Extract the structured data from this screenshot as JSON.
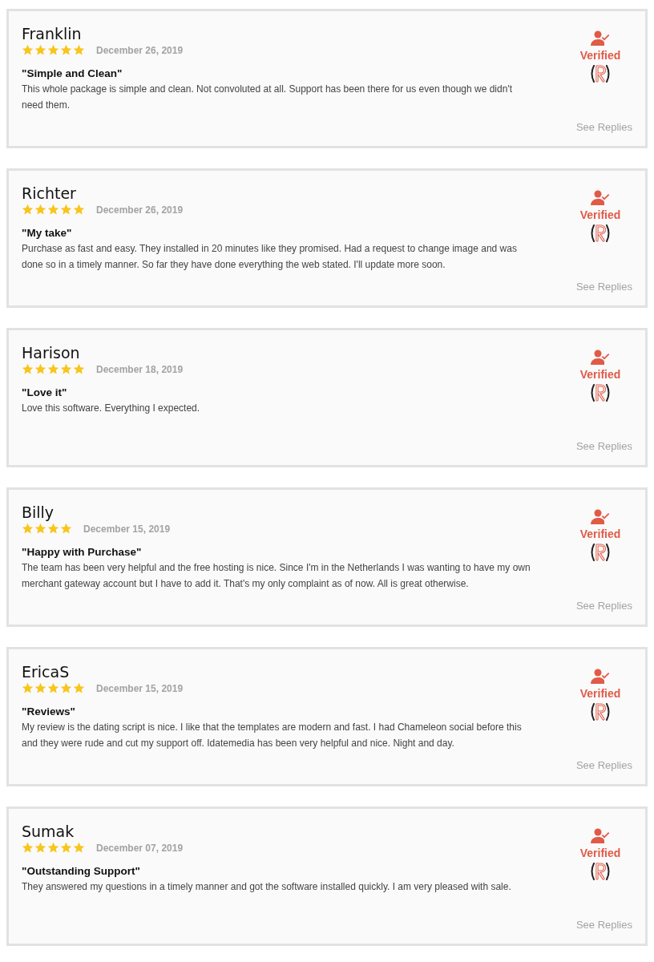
{
  "reviews": [
    {
      "name": "Franklin",
      "stars": 5,
      "date": "December 26, 2019",
      "title": "\"Simple and Clean\"",
      "body": "This whole package is simple and clean. Not convoluted at all. Support has been there for us even though we didn't need them.",
      "verified": "Verified",
      "replies": "See Replies"
    },
    {
      "name": "Richter",
      "stars": 5,
      "date": "December 26, 2019",
      "title": "\"My take\"",
      "body": "Purchase as fast and easy. They installed in 20 minutes like they promised. Had a request to change image and was done so in a timely manner. So far they have done everything the web stated. I'll update more soon.",
      "verified": "Verified",
      "replies": "See Replies"
    },
    {
      "name": "Harison",
      "stars": 5,
      "date": "December 18, 2019",
      "title": "\"Love it\"",
      "body": "Love this software. Everything I expected.",
      "verified": "Verified",
      "replies": "See Replies"
    },
    {
      "name": "Billy",
      "stars": 4,
      "date": "December 15, 2019",
      "title": "\"Happy with Purchase\"",
      "body": "The team has been very helpful and the free hosting is nice. Since I'm in the Netherlands I was wanting to have my own merchant gateway account but I have to add it. That's my only complaint as of now. All is great otherwise.",
      "verified": "Verified",
      "replies": "See Replies"
    },
    {
      "name": "EricaS",
      "stars": 5,
      "date": "December 15, 2019",
      "title": "\"Reviews\"",
      "body": "My review is the dating script is nice. I like that the templates are modern and fast. I had Chameleon social before this and they were rude and cut my support off. Idatemedia has been very helpful and nice. Night and day.",
      "verified": "Verified",
      "replies": "See Replies"
    },
    {
      "name": "Sumak",
      "stars": 5,
      "date": "December 07, 2019",
      "title": "\"Outstanding Support\"",
      "body": "They answered my questions in a timely manner and got the software installed quickly. I am very pleased with sale.",
      "verified": "Verified",
      "replies": "See Replies"
    }
  ]
}
